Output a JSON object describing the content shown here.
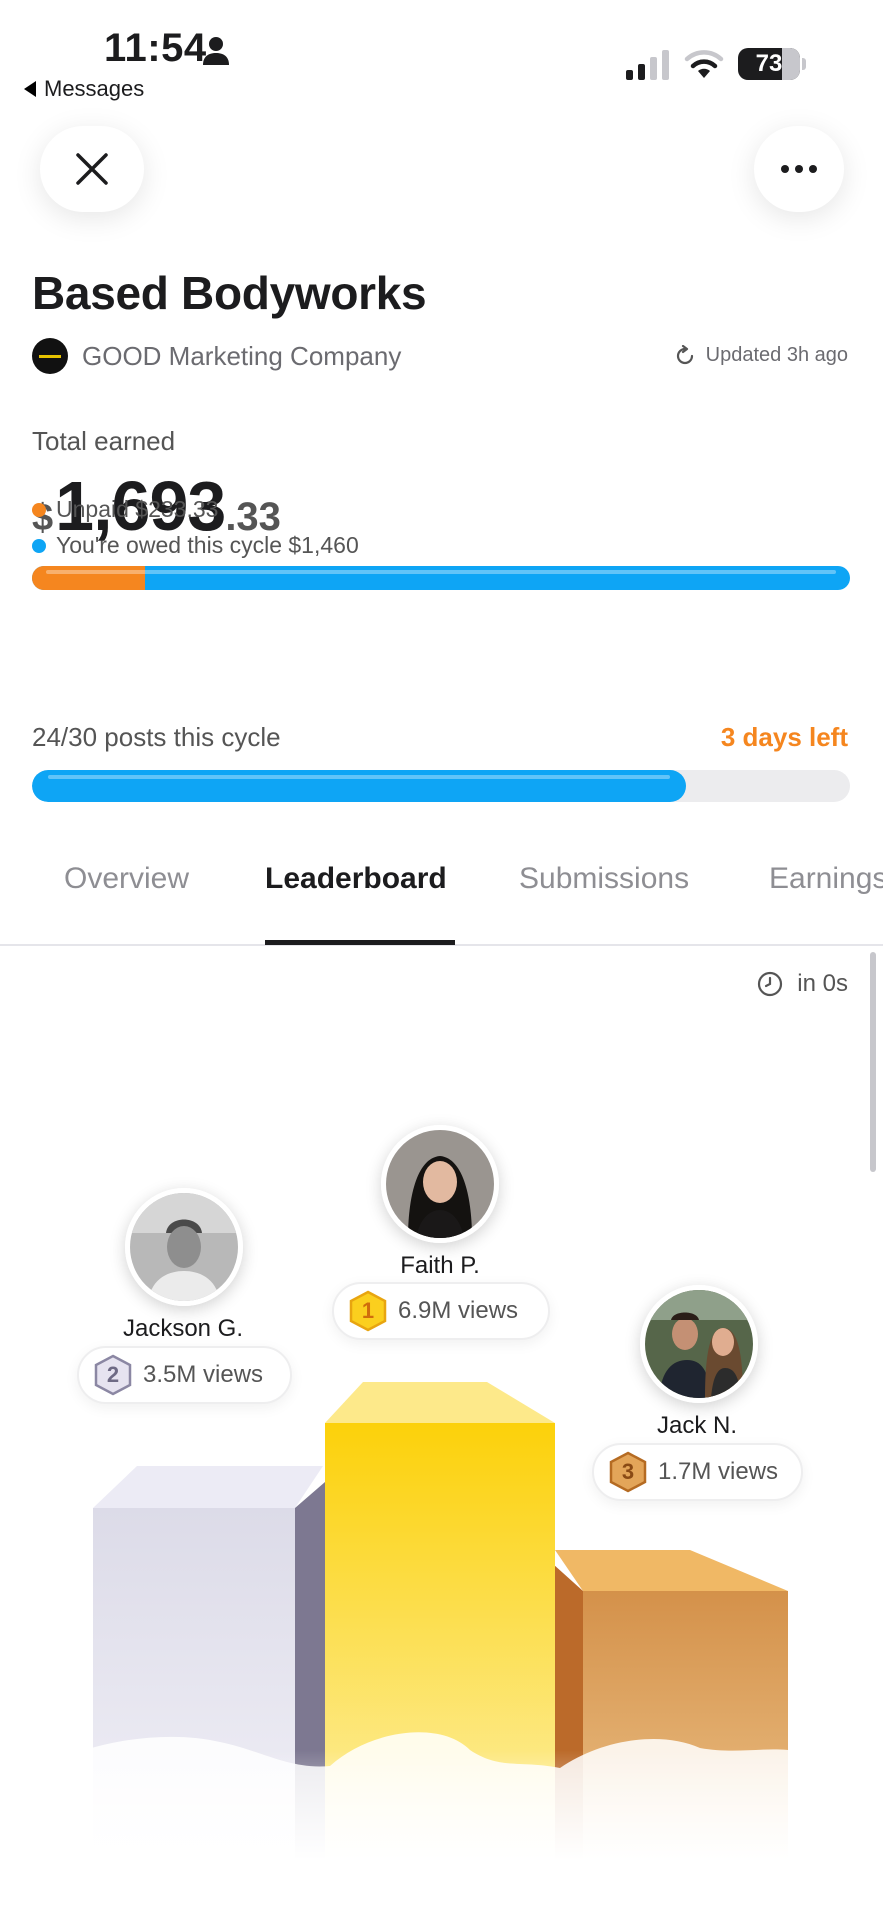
{
  "status_bar": {
    "time": "11:54",
    "back_label": "Messages",
    "battery_level": "73",
    "signal_bars_active": 2,
    "signal_bars_total": 4
  },
  "header": {
    "title": "Based Bodyworks",
    "company": "GOOD Marketing Company",
    "updated": "Updated 3h ago"
  },
  "earnings": {
    "label": "Total earned",
    "currency": "$",
    "amount_main": "1,693",
    "amount_cents": ".33",
    "unpaid_label": "Unpaid $233.33",
    "owed_label": "You're owed this cycle $1,460",
    "unpaid_value": 233.33,
    "owed_value": 1460,
    "unpaid_color": "#f5861f",
    "owed_color": "#0ea5f5"
  },
  "cycle": {
    "posts_label": "24/30 posts this cycle",
    "posts_done": 24,
    "posts_total": 30,
    "days_left": "3 days left"
  },
  "tabs": [
    {
      "label": "Overview",
      "active": false
    },
    {
      "label": "Leaderboard",
      "active": true
    },
    {
      "label": "Submissions",
      "active": false
    },
    {
      "label": "Earnings",
      "active": false
    }
  ],
  "leaderboard": {
    "countdown": "in 0s",
    "entries": [
      {
        "rank": "1",
        "name": "Faith P.",
        "views": "6.9M views",
        "medal": "gold"
      },
      {
        "rank": "2",
        "name": "Jackson G.",
        "views": "3.5M views",
        "medal": "silver"
      },
      {
        "rank": "3",
        "name": "Jack N.",
        "views": "1.7M views",
        "medal": "bronze"
      }
    ]
  }
}
